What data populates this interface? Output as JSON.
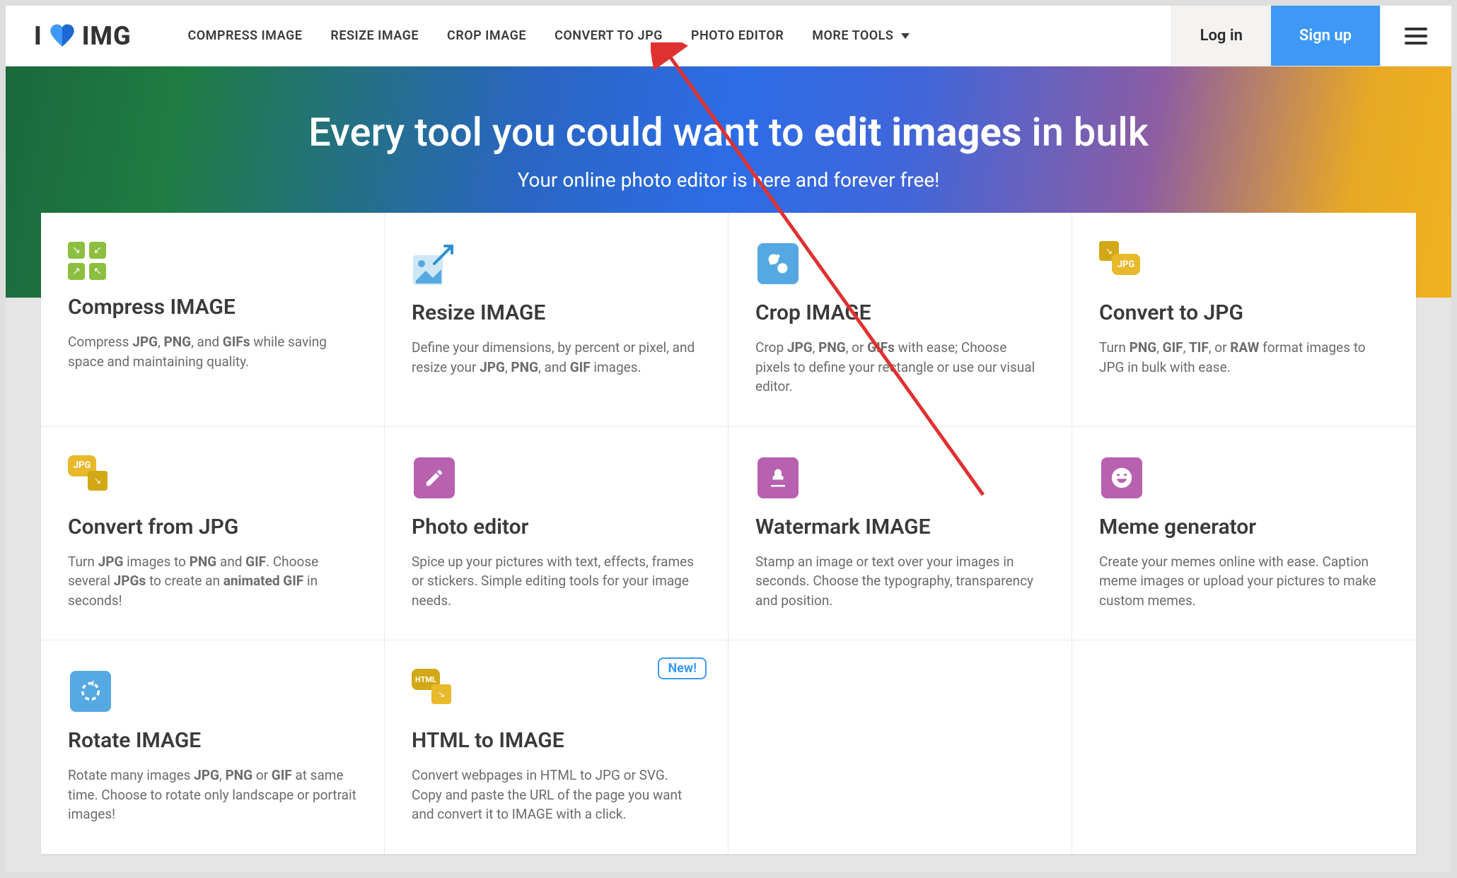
{
  "nav": {
    "logo_prefix": "I",
    "logo_suffix": "IMG",
    "links": [
      "COMPRESS IMAGE",
      "RESIZE IMAGE",
      "CROP IMAGE",
      "CONVERT TO JPG",
      "PHOTO EDITOR",
      "MORE TOOLS"
    ],
    "login": "Log in",
    "signup": "Sign up"
  },
  "hero": {
    "title_lead": "Every tool you could want to ",
    "title_bold": "edit images",
    "title_tail": " in bulk",
    "subtitle": "Your online photo editor is here and forever free!"
  },
  "tools": {
    "compress": {
      "title": "Compress IMAGE",
      "desc": "Compress <strong>JPG</strong>, <strong>PNG</strong>, and <strong>GIFs</strong> while saving space and maintaining quality."
    },
    "resize": {
      "title": "Resize IMAGE",
      "desc": "Define your dimensions, by percent or pixel, and resize your <strong>JPG</strong>, <strong>PNG</strong>, and <strong>GIF</strong> images."
    },
    "crop": {
      "title": "Crop IMAGE",
      "desc": "Crop <strong>JPG</strong>, <strong>PNG</strong>, or <strong>GIFs</strong> with ease; Choose pixels to define your rectangle or use our visual editor."
    },
    "tojpg": {
      "title": "Convert to JPG",
      "desc": "Turn <strong>PNG</strong>, <strong>GIF</strong>, <strong>TIF</strong>, or <strong>RAW</strong> format images to JPG in bulk with ease."
    },
    "fromjpg": {
      "title": "Convert from JPG",
      "desc": "Turn <strong>JPG</strong> images to <strong>PNG</strong> and <strong>GIF</strong>. Choose several <strong>JPGs</strong> to create an <strong>animated GIF</strong> in seconds!"
    },
    "editor": {
      "title": "Photo editor",
      "desc": "Spice up your pictures with text, effects, frames or stickers. Simple editing tools for your image needs."
    },
    "watermark": {
      "title": "Watermark IMAGE",
      "desc": "Stamp an image or text over your images in seconds. Choose the typography, transparency and position."
    },
    "meme": {
      "title": "Meme generator",
      "desc": "Create your memes online with ease. Caption meme images or upload your pictures to make custom memes."
    },
    "rotate": {
      "title": "Rotate IMAGE",
      "desc": "Rotate many images <strong>JPG</strong>, <strong>PNG</strong> or <strong>GIF</strong> at same time. Choose to rotate only landscape or portrait images!"
    },
    "html": {
      "title": "HTML to IMAGE",
      "desc": "Convert webpages in HTML to JPG or SVG. Copy and paste the URL of the page you want and convert it to IMAGE with a click.",
      "badge": "New!"
    }
  }
}
